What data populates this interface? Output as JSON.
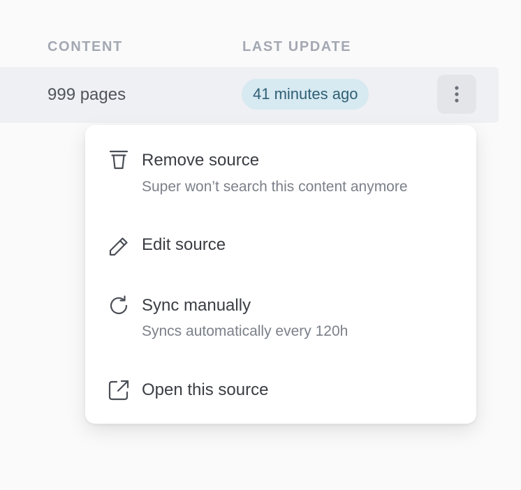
{
  "table": {
    "headers": {
      "content": "CONTENT",
      "last_update": "LAST UPDATE"
    },
    "row": {
      "pages": "999 pages",
      "last_update": "41 minutes ago",
      "more_icon": "more-vertical-icon"
    }
  },
  "menu": {
    "items": [
      {
        "icon": "trash-icon",
        "label": "Remove source",
        "description": "Super won’t search this content anymore"
      },
      {
        "icon": "pencil-icon",
        "label": "Edit source",
        "description": ""
      },
      {
        "icon": "refresh-icon",
        "label": "Sync manually",
        "description": "Syncs automatically every 120h"
      },
      {
        "icon": "external-link-icon",
        "label": "Open this source",
        "description": ""
      }
    ]
  },
  "colors": {
    "row_background": "#eef0f3",
    "badge_background": "#d7e9f1",
    "badge_text": "#2f5f74",
    "header_text": "#a3a8b2"
  }
}
